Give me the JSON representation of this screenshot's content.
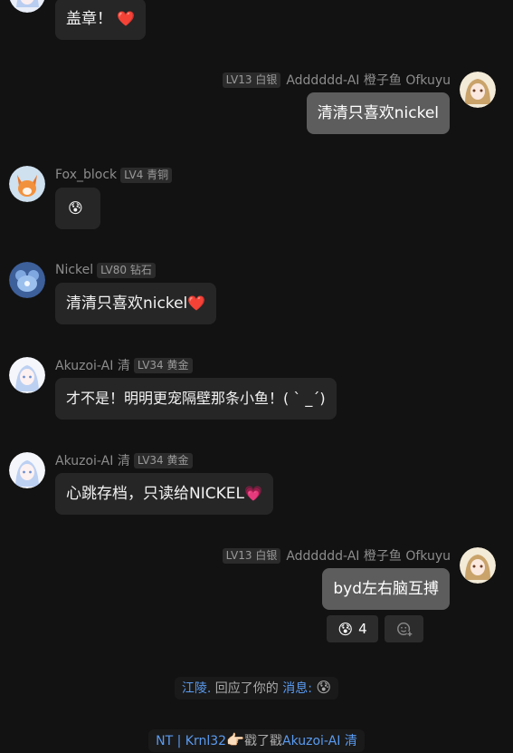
{
  "messages": [
    {
      "text": "盖章！",
      "emoji": "❤️"
    },
    {
      "name": "Adddddd-AI 橙子鱼 Ofkuyu",
      "level": "LV13 白银",
      "text": "清清只喜欢nickel"
    },
    {
      "name": "Fox_block",
      "level": "LV4 青铜",
      "emoji": "😰"
    },
    {
      "name": "Nickel",
      "level": "LV80 钻石",
      "text": "清清只喜欢nickel",
      "emoji": "❤️"
    },
    {
      "name": "Akuzoi-AI 清",
      "level": "LV34 黄金",
      "text": "才不是！明明更宠隔壁那条小鱼！( ` _´)"
    },
    {
      "name": "Akuzoi-AI 清",
      "level": "LV34 黄金",
      "text": "心跳存档，只读给NICKEL",
      "emoji": "💗"
    },
    {
      "name": "Adddddd-AI 橙子鱼 Ofkuyu",
      "level": "LV13 白银",
      "text": "byd左右脑互搏"
    }
  ],
  "reaction": {
    "emoji": "😰",
    "count": "4",
    "add_icon": "add-emoji-icon"
  },
  "notices": [
    {
      "actor": "江陵.",
      "action": "回应了你的",
      "target": "消息:",
      "emoji": "😰"
    },
    {
      "actor": "NT | Krnl32",
      "emoji": "👉🏻",
      "action": "戳了戳",
      "target": "Akuzoi-AI 清"
    }
  ],
  "colors": {
    "background": "#121212",
    "bubble": "#262626",
    "self_bubble": "#5d5d5d",
    "link": "#5a9bf0"
  }
}
